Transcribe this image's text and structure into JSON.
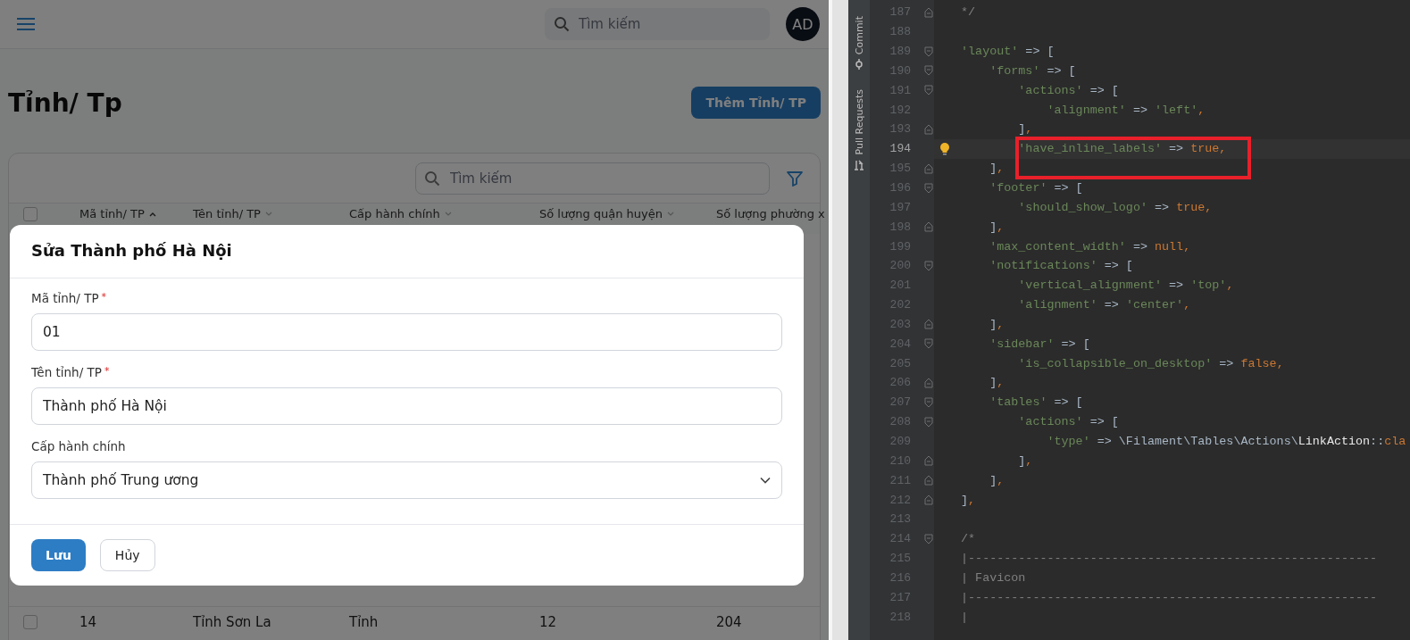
{
  "app": {
    "search_placeholder": "Tìm kiếm",
    "avatar": "AD",
    "page_title": "Tỉnh/ Tp",
    "create_button": "Thêm Tỉnh/ TP",
    "table": {
      "search_placeholder": "Tìm kiếm",
      "all_selected": false,
      "columns": [
        {
          "label": "Mã tỉnh/ TP",
          "sorted": true
        },
        {
          "label": "Tên tỉnh/ TP",
          "sorted": false
        },
        {
          "label": "Cấp hành chính",
          "sorted": false
        },
        {
          "label": "Số lượng quận huyện",
          "sorted": false
        },
        {
          "label": "Số lượng phường x"
        }
      ],
      "rows": [
        {
          "selected": false,
          "cells": [
            "14",
            "Tỉnh Sơn La",
            "Tỉnh",
            "12",
            "204"
          ]
        }
      ]
    },
    "modal": {
      "title": "Sửa Thành phố Hà Nội",
      "fields": [
        {
          "kind": "text",
          "label": "Mã tỉnh/ TP",
          "required_mark": "*",
          "value": "01"
        },
        {
          "kind": "text",
          "label": "Tên tỉnh/ TP",
          "required_mark": "*",
          "value": "Thành phố Hà Nội"
        },
        {
          "kind": "select",
          "label": "Cấp hành chính",
          "value": "Thành phố Trung ương"
        }
      ],
      "buttons": [
        {
          "kind": "primary",
          "label": "Lưu"
        },
        {
          "kind": "secondary",
          "label": "Hủy"
        }
      ]
    }
  },
  "editor": {
    "tool_tabs": [
      {
        "kind": "commit",
        "label": "Commit"
      },
      {
        "kind": "pull-requests",
        "label": "Pull Requests"
      }
    ],
    "lines": [
      {
        "number": "187",
        "fold_end": true,
        "tokens": [
          {
            "kind": "comment",
            "text": " */"
          }
        ]
      },
      {
        "number": "188"
      },
      {
        "number": "189",
        "fold_start": true,
        "tokens": [
          {
            "kind": "string",
            "text": " 'layout'"
          },
          {
            "kind": "plain",
            "text": " => ["
          }
        ]
      },
      {
        "number": "190",
        "fold_start": true,
        "tokens": [
          {
            "kind": "string",
            "text": "     'forms'"
          },
          {
            "kind": "plain",
            "text": " => ["
          }
        ]
      },
      {
        "number": "191",
        "fold_start": true,
        "tokens": [
          {
            "kind": "string",
            "text": "         'actions'"
          },
          {
            "kind": "plain",
            "text": " => ["
          }
        ]
      },
      {
        "number": "192",
        "tokens": [
          {
            "kind": "string",
            "text": "             'alignment'"
          },
          {
            "kind": "plain",
            "text": " => "
          },
          {
            "kind": "string",
            "text": "'left'"
          },
          {
            "kind": "keyword",
            "text": ","
          }
        ]
      },
      {
        "number": "193",
        "fold_end": true,
        "tokens": [
          {
            "kind": "plain",
            "text": "         ]"
          },
          {
            "kind": "keyword",
            "text": ","
          }
        ]
      },
      {
        "number": "194",
        "current": true,
        "intention": true,
        "boxed": true,
        "tokens": [
          {
            "kind": "string",
            "text": "         'have_inline_labels'"
          },
          {
            "kind": "plain",
            "text": " => "
          },
          {
            "kind": "keyword",
            "text": "true,"
          }
        ]
      },
      {
        "number": "195",
        "fold_end": true,
        "tokens": [
          {
            "kind": "plain",
            "text": "     ]"
          },
          {
            "kind": "keyword",
            "text": ","
          }
        ]
      },
      {
        "number": "196",
        "fold_start": true,
        "tokens": [
          {
            "kind": "string",
            "text": "     'footer'"
          },
          {
            "kind": "plain",
            "text": " => ["
          }
        ]
      },
      {
        "number": "197",
        "tokens": [
          {
            "kind": "string",
            "text": "         'should_show_logo'"
          },
          {
            "kind": "plain",
            "text": " => "
          },
          {
            "kind": "keyword",
            "text": "true,"
          }
        ]
      },
      {
        "number": "198",
        "fold_end": true,
        "tokens": [
          {
            "kind": "plain",
            "text": "     ]"
          },
          {
            "kind": "keyword",
            "text": ","
          }
        ]
      },
      {
        "number": "199",
        "tokens": [
          {
            "kind": "string",
            "text": "     'max_content_width'"
          },
          {
            "kind": "plain",
            "text": " => "
          },
          {
            "kind": "keyword",
            "text": "null,"
          }
        ]
      },
      {
        "number": "200",
        "fold_start": true,
        "tokens": [
          {
            "kind": "string",
            "text": "     'notifications'"
          },
          {
            "kind": "plain",
            "text": " => ["
          }
        ]
      },
      {
        "number": "201",
        "tokens": [
          {
            "kind": "string",
            "text": "         'vertical_alignment'"
          },
          {
            "kind": "plain",
            "text": " => "
          },
          {
            "kind": "string",
            "text": "'top'"
          },
          {
            "kind": "keyword",
            "text": ","
          }
        ]
      },
      {
        "number": "202",
        "tokens": [
          {
            "kind": "string",
            "text": "         'alignment'"
          },
          {
            "kind": "plain",
            "text": " => "
          },
          {
            "kind": "string",
            "text": "'center'"
          },
          {
            "kind": "keyword",
            "text": ","
          }
        ]
      },
      {
        "number": "203",
        "fold_end": true,
        "tokens": [
          {
            "kind": "plain",
            "text": "     ]"
          },
          {
            "kind": "keyword",
            "text": ","
          }
        ]
      },
      {
        "number": "204",
        "fold_start": true,
        "tokens": [
          {
            "kind": "string",
            "text": "     'sidebar'"
          },
          {
            "kind": "plain",
            "text": " => ["
          }
        ]
      },
      {
        "number": "205",
        "tokens": [
          {
            "kind": "string",
            "text": "         'is_collapsible_on_desktop'"
          },
          {
            "kind": "plain",
            "text": " => "
          },
          {
            "kind": "keyword",
            "text": "false,"
          }
        ]
      },
      {
        "number": "206",
        "fold_end": true,
        "tokens": [
          {
            "kind": "plain",
            "text": "     ]"
          },
          {
            "kind": "keyword",
            "text": ","
          }
        ]
      },
      {
        "number": "207",
        "fold_start": true,
        "tokens": [
          {
            "kind": "string",
            "text": "     'tables'"
          },
          {
            "kind": "plain",
            "text": " => ["
          }
        ]
      },
      {
        "number": "208",
        "fold_start": true,
        "tokens": [
          {
            "kind": "string",
            "text": "         'actions'"
          },
          {
            "kind": "plain",
            "text": " => ["
          }
        ]
      },
      {
        "number": "209",
        "tokens": [
          {
            "kind": "string",
            "text": "             'type'"
          },
          {
            "kind": "plain",
            "text": " => \\Filament\\Tables\\Actions\\"
          },
          {
            "kind": "class",
            "text": "LinkAction"
          },
          {
            "kind": "plain",
            "text": "::"
          },
          {
            "kind": "keyword",
            "text": "cla"
          }
        ]
      },
      {
        "number": "210",
        "fold_end": true,
        "tokens": [
          {
            "kind": "plain",
            "text": "         ]"
          },
          {
            "kind": "keyword",
            "text": ","
          }
        ]
      },
      {
        "number": "211",
        "fold_end": true,
        "tokens": [
          {
            "kind": "plain",
            "text": "     ]"
          },
          {
            "kind": "keyword",
            "text": ","
          }
        ]
      },
      {
        "number": "212",
        "fold_end": true,
        "tokens": [
          {
            "kind": "plain",
            "text": " ]"
          },
          {
            "kind": "keyword",
            "text": ","
          }
        ]
      },
      {
        "number": "213"
      },
      {
        "number": "214",
        "fold_start": true,
        "tokens": [
          {
            "kind": "comment",
            "text": " /*"
          }
        ]
      },
      {
        "number": "215",
        "tokens": [
          {
            "kind": "comment",
            "text": " |---------------------------------------------------------"
          }
        ]
      },
      {
        "number": "216",
        "tokens": [
          {
            "kind": "comment",
            "text": " | Favicon"
          }
        ]
      },
      {
        "number": "217",
        "tokens": [
          {
            "kind": "comment",
            "text": " |---------------------------------------------------------"
          }
        ]
      },
      {
        "number": "218",
        "tokens": [
          {
            "kind": "comment",
            "text": " |"
          }
        ]
      }
    ]
  }
}
